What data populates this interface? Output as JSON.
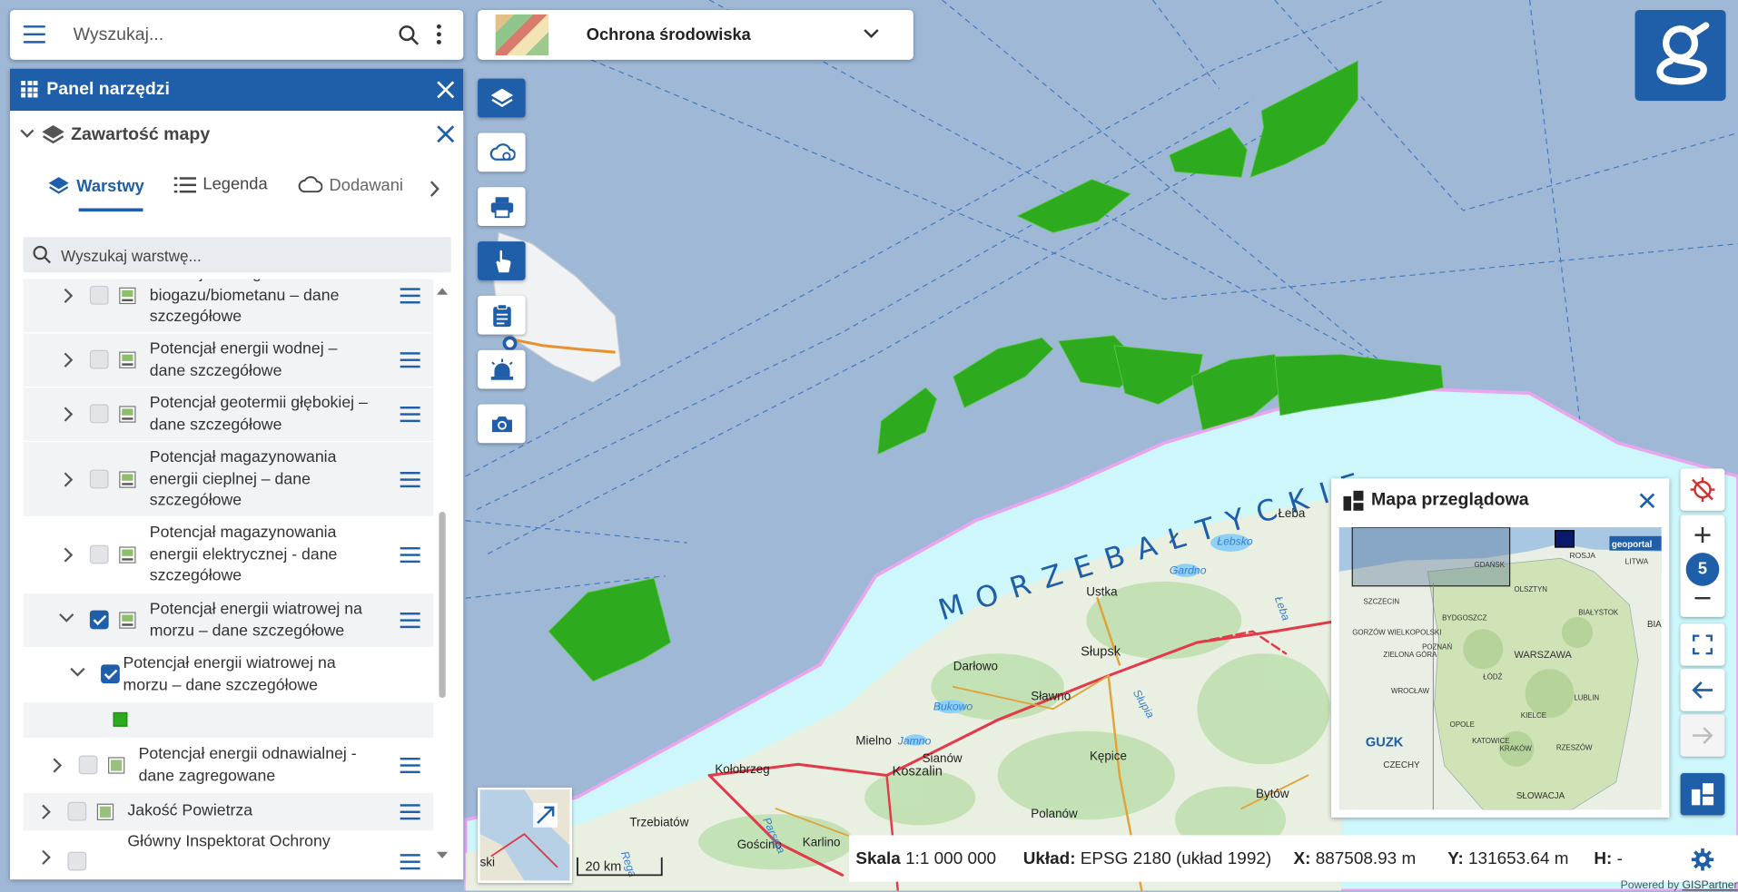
{
  "search": {
    "placeholder": "Wyszukaj..."
  },
  "theme": {
    "label": "Ochrona środowiska"
  },
  "panel": {
    "title": "Panel narzędzi",
    "contents_title": "Zawartość mapy",
    "tabs": [
      {
        "label": "Warstwy",
        "active": true
      },
      {
        "label": "Legenda",
        "active": false
      },
      {
        "label": "Dodawani",
        "active": false
      }
    ],
    "layer_search_placeholder": "Wyszukaj warstwę...",
    "layers": [
      {
        "label": "Potencjał energii z biogazu/biometanu – dane szczegółowe",
        "checked": false
      },
      {
        "label": "Potencjał energii wodnej – dane szczegółowe",
        "checked": false
      },
      {
        "label": "Potencjał geotermii głębokiej – dane szczegółowe",
        "checked": false
      },
      {
        "label": "Potencjał magazynowania energii cieplnej – dane szczegółowe",
        "checked": false
      },
      {
        "label": "Potencjał magazynowania energii elektrycznej - dane szczegółowe",
        "checked": false
      },
      {
        "label": "Potencjał energii wiatrowej na morzu – dane szczegółowe",
        "checked": true
      },
      {
        "label": "Potencjał energii wiatrowej na morzu – dane szczegółowe",
        "checked": true
      },
      {
        "label": "Potencjał energii odnawialnej - dane zagregowane",
        "checked": false
      },
      {
        "label": "Jakość Powietrza",
        "checked": false
      },
      {
        "label": "Główny Inspektorat Ochrony",
        "checked": false
      }
    ],
    "legend_color": "#2eaa1e"
  },
  "map_labels": {
    "sea": "M O R Z E   B A Ł T Y C K I E",
    "towns": [
      "Łeba",
      "Ustka",
      "Słupsk",
      "Darłowo",
      "Sławno",
      "Mielno",
      "Sianów",
      "Koszalin",
      "Kołobrzeg",
      "Kępice",
      "Polanów",
      "Bytów",
      "Trzebiatów",
      "Gościno",
      "Karlino"
    ],
    "lakes": [
      "Łebsko",
      "Gardno",
      "Bukowo",
      "Jamno"
    ],
    "rivers": [
      "Łeba",
      "Słupia",
      "Parsęta",
      "Rega"
    ]
  },
  "overview": {
    "title": "Mapa przeglądowa",
    "cities": [
      "GDAŃSK",
      "ROSJA",
      "LITWA",
      "SZCZECIN",
      "BYDGOSZCZ",
      "OLSZTYN",
      "GORZÓW WIELKOPOLSKI",
      "POZNAŃ",
      "BIAŁYSTOK",
      "WARSZAWA",
      "ZIELONA GÓRA",
      "ŁÓDŹ",
      "WROCŁAW",
      "OPOLE",
      "KIELCE",
      "LUBLIN",
      "KATOWICE",
      "KRAKÓW",
      "RZESZÓW",
      "CZECHY",
      "SŁOWACJA",
      "BIA"
    ],
    "logo_left": "GUZK",
    "logo_right": "geoportal"
  },
  "zoom": {
    "level": "5"
  },
  "status": {
    "scale_label": "Skala",
    "scale_value": "1:1 000 000",
    "crs_label": "Układ:",
    "crs_value": "EPSG 2180 (układ 1992)",
    "x_label": "X:",
    "x_value": "887508.93 m",
    "y_label": "Y:",
    "y_value": "131653.64 m",
    "h_label": "H:",
    "h_value": "-"
  },
  "scalebar": {
    "label": "20 km"
  },
  "minimap_text": "ski",
  "powered": {
    "prefix": "Powered by ",
    "brand": "GISPartner"
  },
  "colors": {
    "accent": "#1f5ea8",
    "sea": "#9fb8d6",
    "coastal": "#cdf7fb",
    "wind_area": "#2eaa1e"
  }
}
